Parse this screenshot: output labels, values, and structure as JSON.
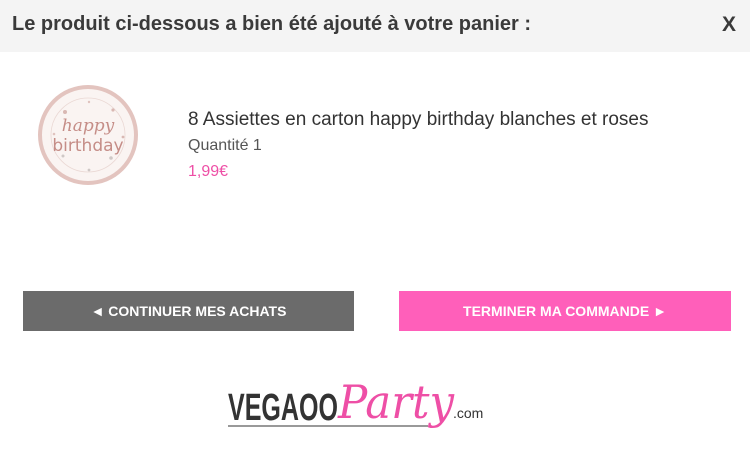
{
  "dialog": {
    "title": "Le produit ci-dessous a bien été ajouté à votre panier :",
    "close_label": "X"
  },
  "product": {
    "name": "8 Assiettes en carton happy birthday blanches et roses",
    "quantity": "Quantité 1",
    "price": "1,99€",
    "price_color": "#ee4fa6",
    "image_text_line1": "happy",
    "image_text_line2": "birthday"
  },
  "buttons": {
    "continue_label": "◄ CONTINUER MES ACHATS",
    "checkout_label": "TERMINER MA COMMANDE ►",
    "continue_color": "#6b6b6b",
    "checkout_color": "#ff5fba"
  },
  "logo": {
    "part1": "VEGAOO",
    "part2": "Party",
    "suffix": ".com",
    "accent_color": "#ee4fa6"
  }
}
